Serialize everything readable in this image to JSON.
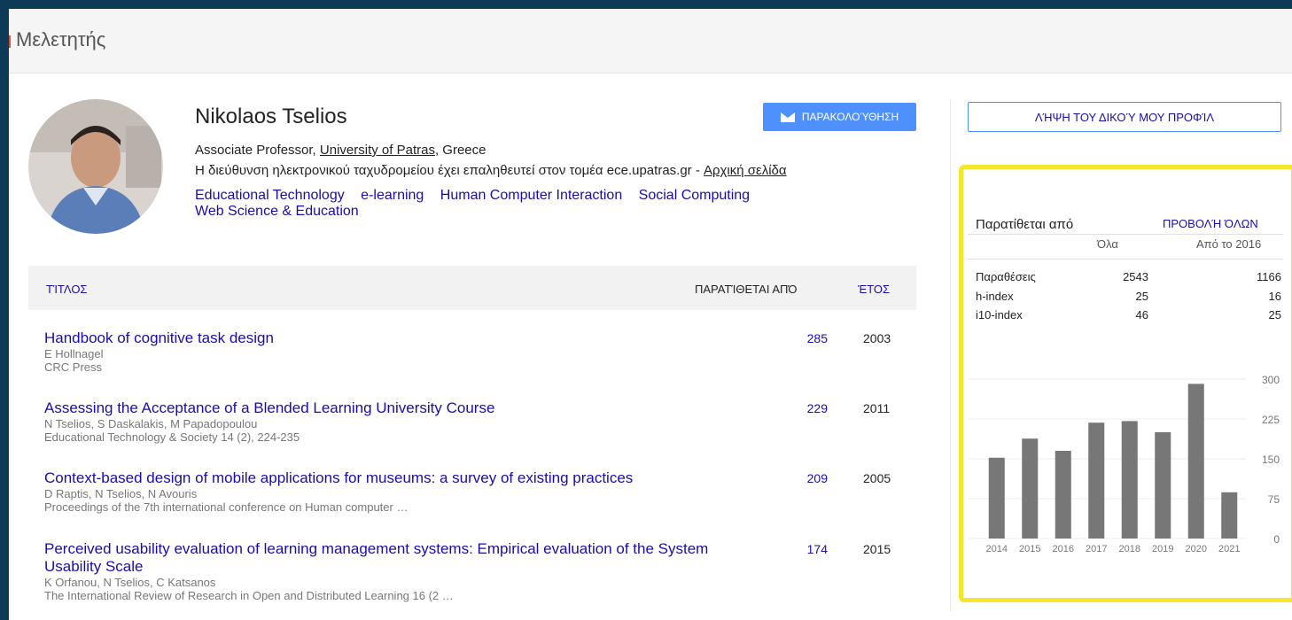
{
  "header": {
    "logo_text": "Μελετητής"
  },
  "profile": {
    "name": "Nikolaos Tselios",
    "affiliation_prefix": "Associate Professor, ",
    "affiliation_link": "University of Patras",
    "affiliation_suffix": ", Greece",
    "email_text": "Η διεύθυνση ηλεκτρονικού ταχυδρομείου έχει επαληθευτεί στον τομέα ece.upatras.gr - ",
    "homepage_link": "Αρχική σελίδα",
    "interests": [
      "Educational Technology",
      "e-learning",
      "Human Computer Interaction",
      "Social Computing",
      "Web Science & Education"
    ],
    "follow_label": "ΠΑΡΑΚΟΛΟΎΘΗΣΗ"
  },
  "table": {
    "col_title": "ΤΊΤΛΟΣ",
    "col_cited": "ΠΑΡΑΤΊΘΕΤΑΙ ΑΠΌ",
    "col_year": "ΈΤΟΣ",
    "rows": [
      {
        "title": "Handbook of cognitive task design",
        "authors": "E Hollnagel",
        "venue": "CRC Press",
        "cited": "285",
        "year": "2003"
      },
      {
        "title": "Assessing the Acceptance of a Blended Learning University Course",
        "authors": "N Tselios, S Daskalakis, M Papadopoulou",
        "venue": "Educational Technology & Society 14 (2), 224-235",
        "cited": "229",
        "year": "2011"
      },
      {
        "title": "Context-based design of mobile applications for museums: a survey of existing practices",
        "authors": "D Raptis, N Tselios, N Avouris",
        "venue": "Proceedings of the 7th international conference on Human computer …",
        "cited": "209",
        "year": "2005"
      },
      {
        "title": "Perceived usability evaluation of learning management systems: Empirical evaluation of the System Usability Scale",
        "authors": "K Orfanou, N Tselios, C Katsanos",
        "venue": "The International Review of Research in Open and Distributed Learning 16 (2 …",
        "cited": "174",
        "year": "2015"
      }
    ]
  },
  "sidebar": {
    "own_profile_label": "ΛΉΨΗ ΤΟΥ ΔΙΚΟΎ ΜΟΥ ΠΡΟΦΊΛ",
    "cited_by_title": "Παρατίθεται από",
    "view_all": "ΠΡΟΒΟΛΉ ΌΛΩΝ",
    "col_all": "Όλα",
    "col_since": "Από το 2016",
    "stats": [
      {
        "label": "Παραθέσεις",
        "all": "2543",
        "since": "1166"
      },
      {
        "label": "h-index",
        "all": "25",
        "since": "16"
      },
      {
        "label": "i10-index",
        "all": "46",
        "since": "25"
      }
    ]
  },
  "colors": {
    "link": "#1a0dab",
    "accent": "#4d90fe",
    "bar": "#777777",
    "highlight": "#f5e52f"
  },
  "chart_data": {
    "type": "bar",
    "categories": [
      "2014",
      "2015",
      "2016",
      "2017",
      "2018",
      "2019",
      "2020",
      "2021"
    ],
    "values": [
      152,
      188,
      165,
      218,
      221,
      200,
      291,
      87
    ],
    "ylim": [
      0,
      300
    ],
    "yticks": [
      "0",
      "75",
      "150",
      "225",
      "300"
    ]
  }
}
